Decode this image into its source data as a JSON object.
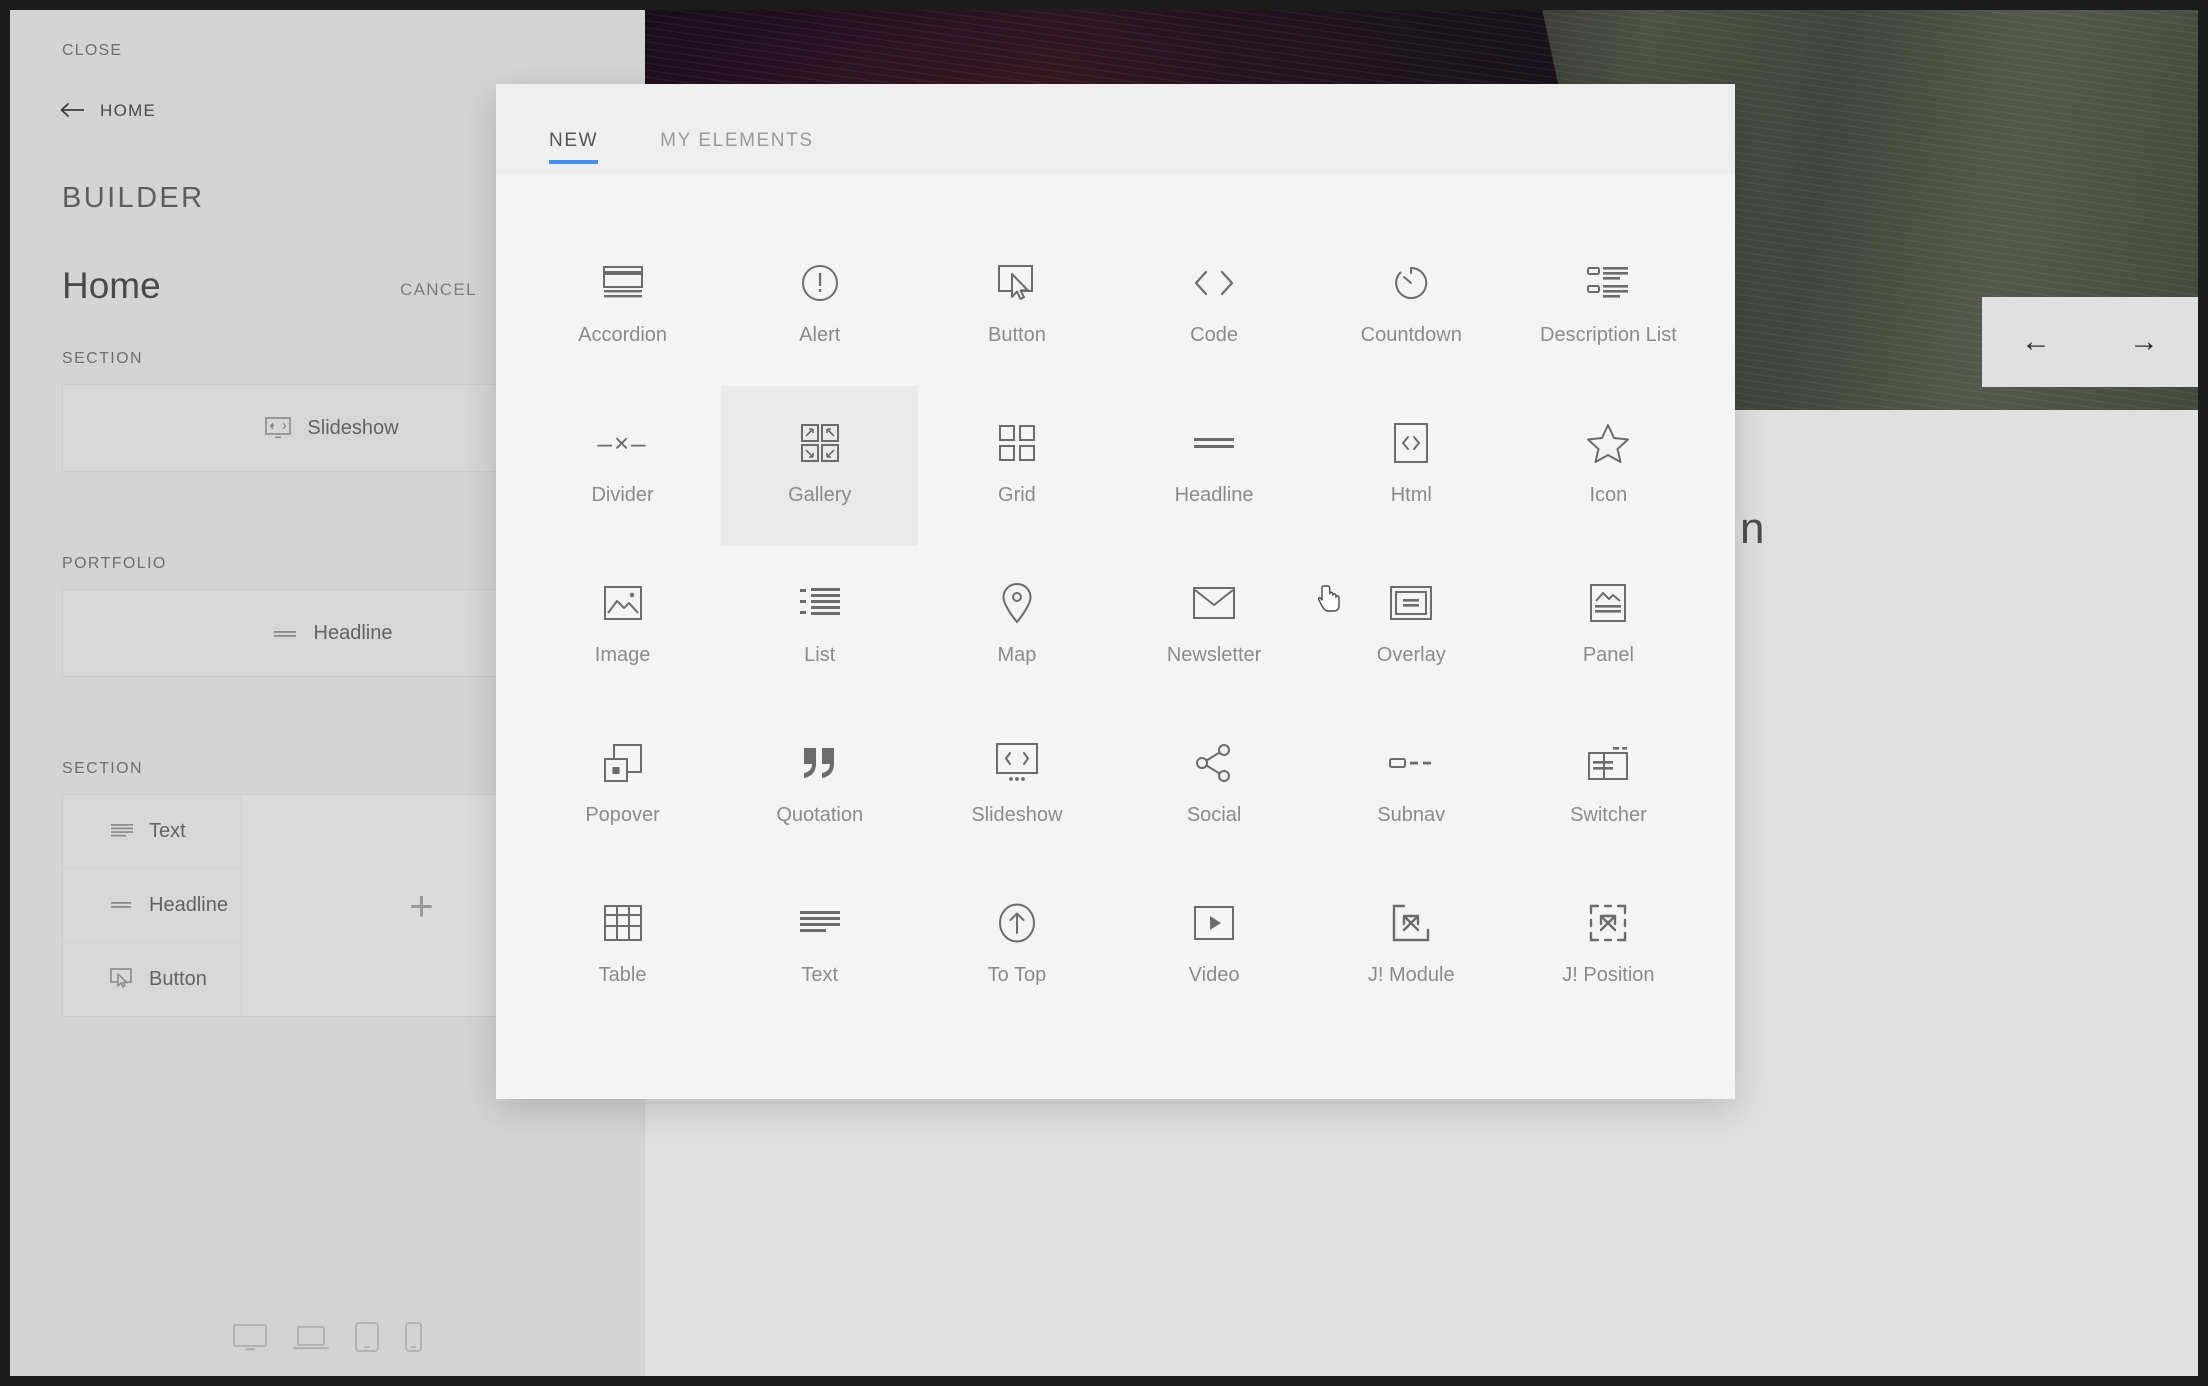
{
  "sidebar": {
    "close_label": "CLOSE",
    "back_label": "HOME",
    "back_icon": "arrow-left-icon",
    "builder_label": "BUILDER",
    "page_title": "Home",
    "cancel_label": "CANCEL",
    "save_color": "#3d7ecc",
    "groups": [
      {
        "label": "SECTION",
        "item": "Slideshow",
        "icon": "slideshow-icon"
      },
      {
        "label": "PORTFOLIO",
        "item": "Headline",
        "icon": "headline-icon"
      }
    ],
    "last_group": {
      "label": "SECTION",
      "items": [
        {
          "label": "Text",
          "icon": "text-icon"
        },
        {
          "label": "Headline",
          "icon": "headline-icon"
        },
        {
          "label": "Button",
          "icon": "button-icon"
        }
      ],
      "add_label": "+"
    },
    "devices": [
      {
        "name": "desktop-icon"
      },
      {
        "name": "laptop-icon"
      },
      {
        "name": "tablet-icon"
      },
      {
        "name": "phone-icon"
      }
    ]
  },
  "canvas": {
    "prev_label": "←",
    "next_label": "→",
    "visible_text": "n"
  },
  "modal": {
    "tabs": [
      {
        "label": "NEW",
        "active": true
      },
      {
        "label": "MY ELEMENTS",
        "active": false
      }
    ],
    "accent_color": "#4a90e2",
    "selected_element": "Gallery",
    "elements": [
      {
        "label": "Accordion",
        "icon": "accordion-icon"
      },
      {
        "label": "Alert",
        "icon": "alert-icon"
      },
      {
        "label": "Button",
        "icon": "button-icon"
      },
      {
        "label": "Code",
        "icon": "code-icon"
      },
      {
        "label": "Countdown",
        "icon": "countdown-icon"
      },
      {
        "label": "Description List",
        "icon": "description-list-icon"
      },
      {
        "label": "Divider",
        "icon": "divider-icon"
      },
      {
        "label": "Gallery",
        "icon": "gallery-icon"
      },
      {
        "label": "Grid",
        "icon": "grid-icon"
      },
      {
        "label": "Headline",
        "icon": "headline-icon"
      },
      {
        "label": "Html",
        "icon": "html-icon"
      },
      {
        "label": "Icon",
        "icon": "star-icon"
      },
      {
        "label": "Image",
        "icon": "image-icon"
      },
      {
        "label": "List",
        "icon": "list-icon"
      },
      {
        "label": "Map",
        "icon": "map-pin-icon"
      },
      {
        "label": "Newsletter",
        "icon": "envelope-icon"
      },
      {
        "label": "Overlay",
        "icon": "overlay-icon"
      },
      {
        "label": "Panel",
        "icon": "panel-icon"
      },
      {
        "label": "Popover",
        "icon": "popover-icon"
      },
      {
        "label": "Quotation",
        "icon": "quote-icon"
      },
      {
        "label": "Slideshow",
        "icon": "slideshow-icon"
      },
      {
        "label": "Social",
        "icon": "share-icon"
      },
      {
        "label": "Subnav",
        "icon": "subnav-icon"
      },
      {
        "label": "Switcher",
        "icon": "switcher-icon"
      },
      {
        "label": "Table",
        "icon": "table-icon"
      },
      {
        "label": "Text",
        "icon": "text-icon"
      },
      {
        "label": "To Top",
        "icon": "to-top-icon"
      },
      {
        "label": "Video",
        "icon": "video-icon"
      },
      {
        "label": "J! Module",
        "icon": "joomla-module-icon"
      },
      {
        "label": "J! Position",
        "icon": "joomla-position-icon"
      }
    ]
  }
}
